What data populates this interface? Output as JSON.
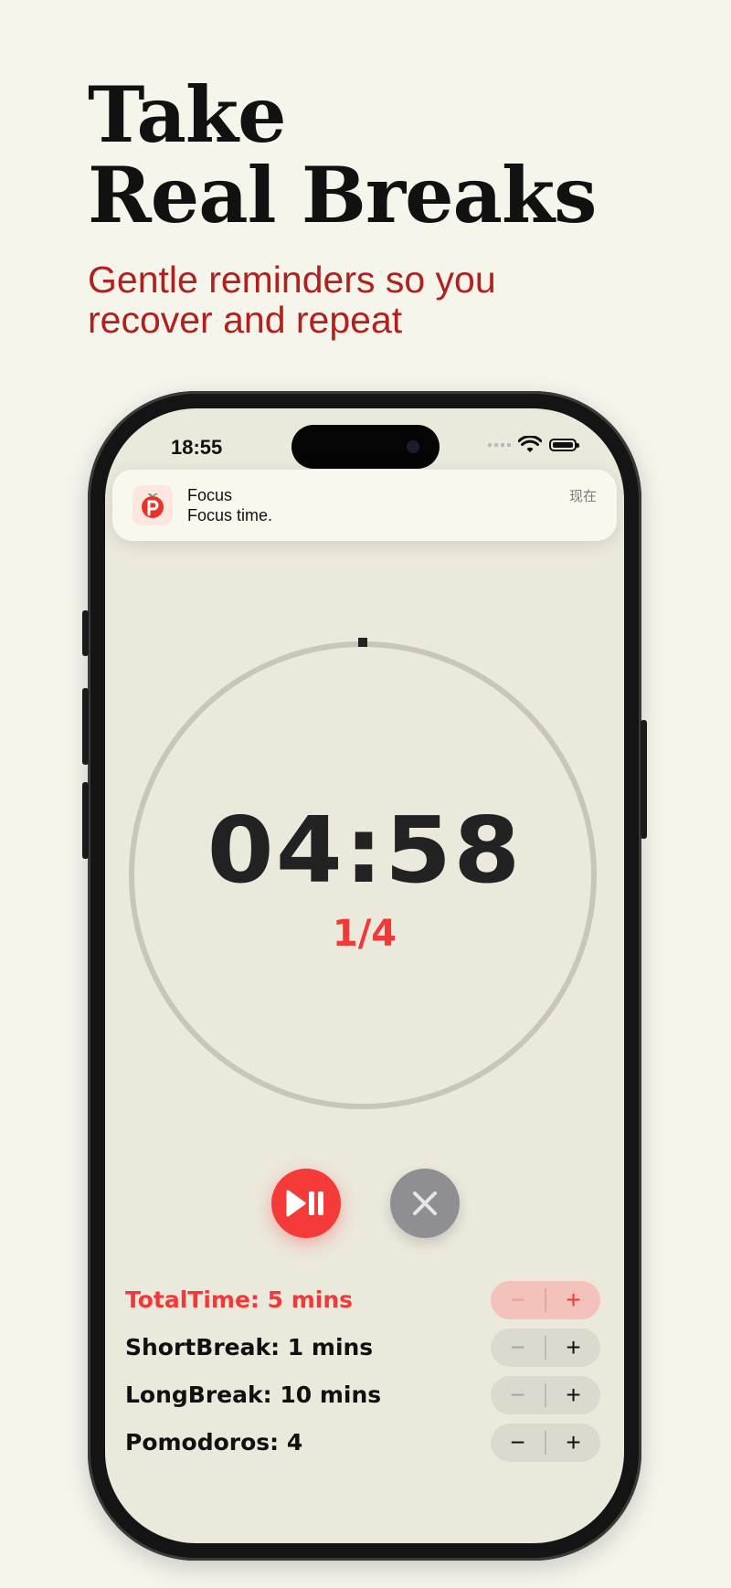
{
  "headline": {
    "line1": "Take",
    "line2": "Real Breaks"
  },
  "subhead": {
    "line1": "Gentle reminders so you",
    "line2": "recover and repeat"
  },
  "status_bar": {
    "time": "18:55"
  },
  "notification": {
    "app": "Focus",
    "message": "Focus time.",
    "time": "现在",
    "icon": "tomato-timer-icon"
  },
  "timer": {
    "remaining": "04:58",
    "cycle": "1/4"
  },
  "controls": {
    "play_pause_icon": "play-pause-icon",
    "stop_icon": "close-icon"
  },
  "settings": [
    {
      "label": "TotalTime: 5 mins",
      "minus": "−",
      "plus": "+"
    },
    {
      "label": "ShortBreak: 1 mins",
      "minus": "−",
      "plus": "+"
    },
    {
      "label": "LongBreak: 10 mins",
      "minus": "−",
      "plus": "+"
    },
    {
      "label": "Pomodoros: 4",
      "minus": "−",
      "plus": "+"
    }
  ],
  "colors": {
    "accent": "#f33838",
    "headline_red": "#b1201d",
    "background": "#f6f5ec",
    "screen": "#ebe8dc"
  }
}
